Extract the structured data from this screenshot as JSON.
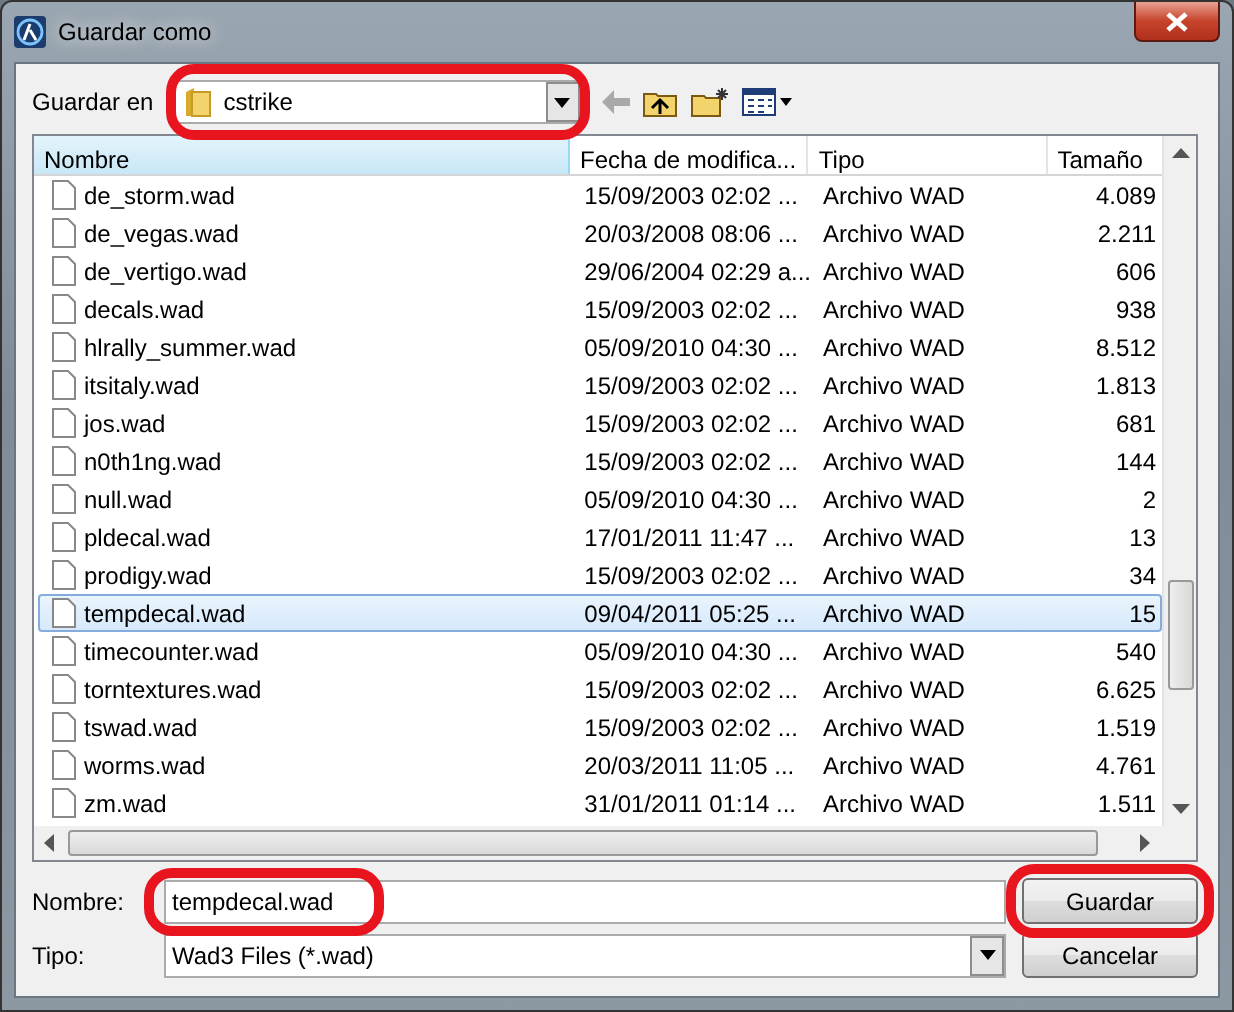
{
  "window": {
    "title": "Guardar como"
  },
  "save_in": {
    "label": "Guardar en",
    "value": "cstrike",
    "highlighted": true
  },
  "columns": [
    {
      "label": "Nombre",
      "sorted": true
    },
    {
      "label": "Fecha de modifica...",
      "sorted": false
    },
    {
      "label": "Tipo",
      "sorted": false
    },
    {
      "label": "Tamaño",
      "sorted": false
    }
  ],
  "rows": [
    {
      "name": "de_storm.wad",
      "date": "15/09/2003 02:02 ...",
      "type": "Archivo WAD",
      "size": "4.089",
      "selected": false
    },
    {
      "name": "de_vegas.wad",
      "date": "20/03/2008 08:06 ...",
      "type": "Archivo WAD",
      "size": "2.211",
      "selected": false
    },
    {
      "name": "de_vertigo.wad",
      "date": "29/06/2004 02:29 a...",
      "type": "Archivo WAD",
      "size": "606",
      "selected": false
    },
    {
      "name": "decals.wad",
      "date": "15/09/2003 02:02 ...",
      "type": "Archivo WAD",
      "size": "938",
      "selected": false
    },
    {
      "name": "hlrally_summer.wad",
      "date": "05/09/2010 04:30 ...",
      "type": "Archivo WAD",
      "size": "8.512",
      "selected": false
    },
    {
      "name": "itsitaly.wad",
      "date": "15/09/2003 02:02 ...",
      "type": "Archivo WAD",
      "size": "1.813",
      "selected": false
    },
    {
      "name": "jos.wad",
      "date": "15/09/2003 02:02 ...",
      "type": "Archivo WAD",
      "size": "681",
      "selected": false
    },
    {
      "name": "n0th1ng.wad",
      "date": "15/09/2003 02:02 ...",
      "type": "Archivo WAD",
      "size": "144",
      "selected": false
    },
    {
      "name": "null.wad",
      "date": "05/09/2010 04:30 ...",
      "type": "Archivo WAD",
      "size": "2",
      "selected": false
    },
    {
      "name": "pldecal.wad",
      "date": "17/01/2011 11:47 ...",
      "type": "Archivo WAD",
      "size": "13",
      "selected": false
    },
    {
      "name": "prodigy.wad",
      "date": "15/09/2003 02:02 ...",
      "type": "Archivo WAD",
      "size": "34",
      "selected": false
    },
    {
      "name": "tempdecal.wad",
      "date": "09/04/2011 05:25 ...",
      "type": "Archivo WAD",
      "size": "15",
      "selected": true
    },
    {
      "name": "timecounter.wad",
      "date": "05/09/2010 04:30 ...",
      "type": "Archivo WAD",
      "size": "540",
      "selected": false
    },
    {
      "name": "torntextures.wad",
      "date": "15/09/2003 02:02 ...",
      "type": "Archivo WAD",
      "size": "6.625",
      "selected": false
    },
    {
      "name": "tswad.wad",
      "date": "15/09/2003 02:02 ...",
      "type": "Archivo WAD",
      "size": "1.519",
      "selected": false
    },
    {
      "name": "worms.wad",
      "date": "20/03/2011 11:05 ...",
      "type": "Archivo WAD",
      "size": "4.761",
      "selected": false
    },
    {
      "name": "zm.wad",
      "date": "31/01/2011 01:14 ...",
      "type": "Archivo WAD",
      "size": "1.511",
      "selected": false
    }
  ],
  "filename": {
    "label": "Nombre:",
    "value": "tempdecal.wad",
    "highlighted": true
  },
  "filetype": {
    "label": "Tipo:",
    "value": "Wad3 Files (*.wad)"
  },
  "buttons": [
    {
      "label": "Guardar",
      "highlighted": true
    },
    {
      "label": "Cancelar",
      "highlighted": false
    }
  ]
}
